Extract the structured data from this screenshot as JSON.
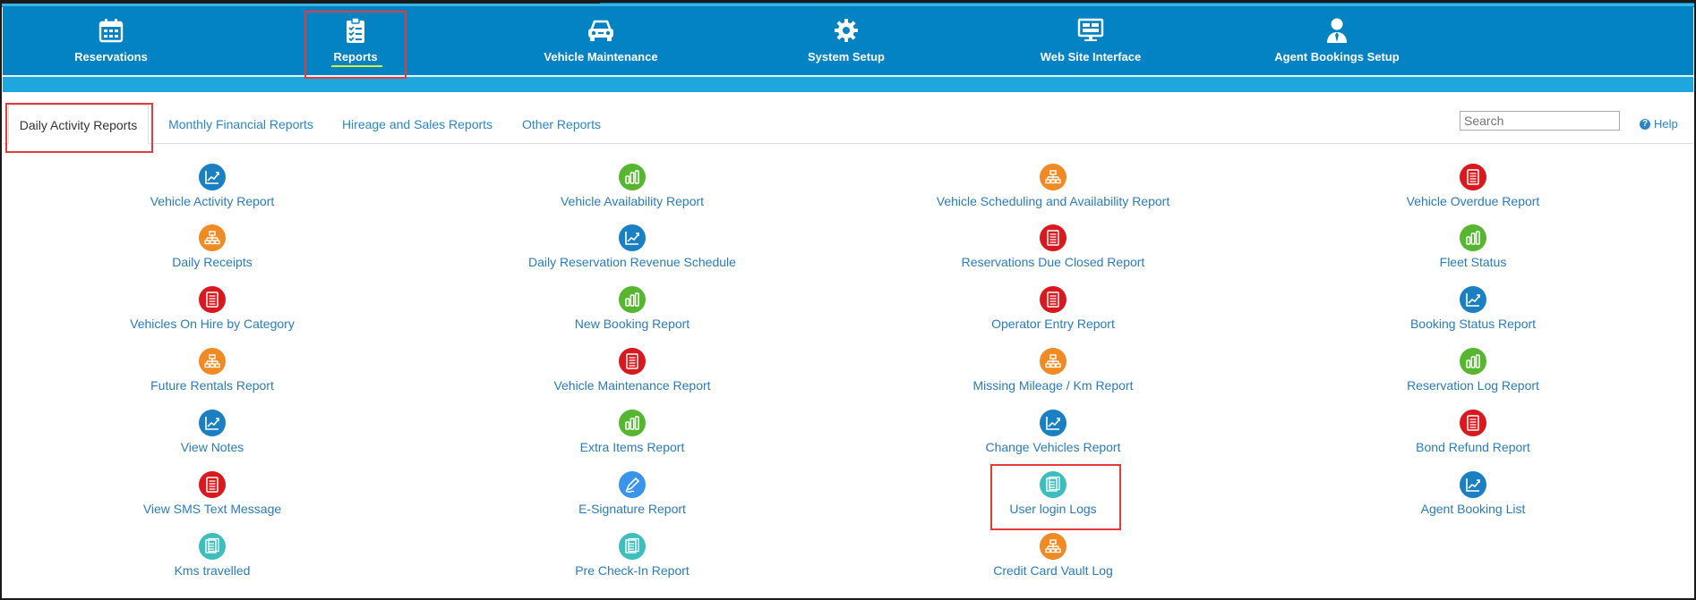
{
  "nav": {
    "items": [
      {
        "label": "Reservations",
        "icon": "calendar-icon"
      },
      {
        "label": "Reports",
        "icon": "clipboard-checklist-icon"
      },
      {
        "label": "Vehicle Maintenance",
        "icon": "car-icon"
      },
      {
        "label": "System Setup",
        "icon": "gear-icon"
      },
      {
        "label": "Web Site Interface",
        "icon": "monitor-icon"
      },
      {
        "label": "Agent Bookings Setup",
        "icon": "agent-icon"
      }
    ],
    "active": "Reports"
  },
  "tabs": [
    {
      "label": "Daily Activity Reports"
    },
    {
      "label": "Monthly Financial Reports"
    },
    {
      "label": "Hireage and Sales Reports"
    },
    {
      "label": "Other Reports"
    }
  ],
  "search": {
    "placeholder": "Search"
  },
  "help": {
    "label": "Help"
  },
  "colors": {
    "navbar": "#0383c4",
    "link": "#2a7bbd",
    "highlight": "#e23c3c",
    "icon_blue": "#1b80c2",
    "icon_green": "#56b62f",
    "icon_orange": "#f08a24",
    "icon_red": "#d8191f",
    "icon_teal": "#3ebdbd"
  },
  "reports": {
    "col1": [
      {
        "label": "Vehicle Activity Report",
        "icon": "line-chart-icon"
      },
      {
        "label": "Daily Receipts",
        "icon": "hierarchy-icon"
      },
      {
        "label": "Vehicles On Hire by Category",
        "icon": "document-icon"
      },
      {
        "label": "Future Rentals Report",
        "icon": "hierarchy-icon"
      },
      {
        "label": "View Notes",
        "icon": "line-chart-icon"
      },
      {
        "label": "View SMS Text Message",
        "icon": "document-icon"
      },
      {
        "label": "Kms travelled",
        "icon": "log-icon"
      }
    ],
    "col2": [
      {
        "label": "Vehicle Availability Report",
        "icon": "bar-chart-icon"
      },
      {
        "label": "Daily Reservation Revenue Schedule",
        "icon": "line-chart-icon"
      },
      {
        "label": "New Booking Report",
        "icon": "bar-chart-icon"
      },
      {
        "label": "Vehicle Maintenance Report",
        "icon": "document-icon"
      },
      {
        "label": "Extra Items Report",
        "icon": "bar-chart-icon"
      },
      {
        "label": "E-Signature Report",
        "icon": "pen-icon"
      },
      {
        "label": "Pre Check-In Report",
        "icon": "log-icon"
      }
    ],
    "col3": [
      {
        "label": "Vehicle Scheduling and Availability Report",
        "icon": "hierarchy-icon"
      },
      {
        "label": "Reservations Due Closed Report",
        "icon": "document-icon"
      },
      {
        "label": "Operator Entry Report",
        "icon": "document-icon"
      },
      {
        "label": "Missing Mileage / Km Report",
        "icon": "hierarchy-icon"
      },
      {
        "label": "Change Vehicles Report",
        "icon": "line-chart-icon"
      },
      {
        "label": "User login Logs",
        "icon": "log-icon"
      },
      {
        "label": "Credit Card Vault Log",
        "icon": "hierarchy-icon"
      }
    ],
    "col4": [
      {
        "label": "Vehicle Overdue Report",
        "icon": "document-icon"
      },
      {
        "label": "Fleet Status",
        "icon": "bar-chart-icon"
      },
      {
        "label": "Booking Status Report",
        "icon": "line-chart-icon"
      },
      {
        "label": "Reservation Log Report",
        "icon": "bar-chart-icon"
      },
      {
        "label": "Bond Refund Report",
        "icon": "document-icon"
      },
      {
        "label": "Agent Booking List",
        "icon": "line-chart-icon"
      }
    ]
  }
}
